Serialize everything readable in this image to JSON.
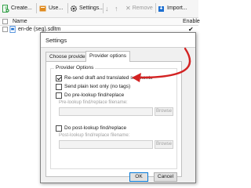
{
  "toolbar": {
    "create_label": "Create...",
    "use_label": "Use...",
    "settings_label": "Settings...",
    "remove_label": "Remove",
    "import_label": "Import..."
  },
  "grid": {
    "col_name": "Name",
    "col_enabled": "Enable",
    "rows": [
      {
        "name": "en-de (seg).sdltm",
        "enabled": true
      }
    ]
  },
  "dialog": {
    "title": "Settings",
    "tabs": [
      {
        "label": "Choose provider",
        "active": false
      },
      {
        "label": "Provider options",
        "active": true
      }
    ],
    "group_title": "Provider Options",
    "options": {
      "resend": {
        "label": "Re-send draft and translated segments",
        "checked": true
      },
      "plain_text": {
        "label": "Send plain text only (no tags)",
        "checked": false
      },
      "pre_lookup": {
        "label": "Do pre-lookup find/replace",
        "checked": false
      },
      "post_lookup": {
        "label": "Do post-lookup find/replace",
        "checked": false
      }
    },
    "pre_file_label": "Pre-lookup find/replace filename:",
    "post_file_label": "Post-lookup find/replace filename:",
    "browse_label": "Browse",
    "ok_label": "OK",
    "cancel_label": "Cancel"
  },
  "colors": {
    "accent_arrow": "#d32222",
    "icon_green": "#2f9e44",
    "icon_blue": "#1c6fd1",
    "icon_orange": "#e08a1e"
  }
}
